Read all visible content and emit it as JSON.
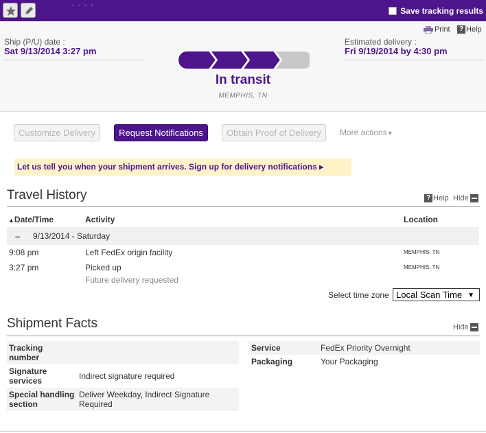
{
  "topbar": {
    "save_label": "Save tracking results",
    "dots": "- - - -"
  },
  "summary": {
    "print_label": "Print",
    "help_label": "Help",
    "ship_label": "Ship (P/U) date :",
    "ship_value": "Sat 9/13/2014 3:27 pm",
    "est_label": "Estimated delivery :",
    "est_value": "Fri 9/19/2014 by 4:30 pm",
    "progress_steps_completed": 3,
    "progress_steps_total": 4,
    "status": "In transit",
    "status_location": "MEMPHIS, TN"
  },
  "actions": {
    "customize": "Customize Delivery",
    "request": "Request Notifications",
    "proof": "Obtain Proof of Delivery",
    "more": "More actions"
  },
  "banner": {
    "text": "Let us tell you when your shipment arrives. Sign up for delivery notifications ▸"
  },
  "travel": {
    "title": "Travel History",
    "help": "Help",
    "hide": "Hide",
    "col_date": "Date/Time",
    "col_activity": "Activity",
    "col_location": "Location",
    "date_group": "9/13/2014 - Saturday",
    "rows": [
      {
        "time": "9:08 pm",
        "activity": "Left FedEx origin facility",
        "location": "MEMPHIS, TN",
        "note": ""
      },
      {
        "time": "3:27 pm",
        "activity": "Picked up",
        "location": "MEMPHIS, TN",
        "note": "Future delivery requested"
      }
    ],
    "tz_label": "Select time zone",
    "tz_value": "Local Scan Time"
  },
  "facts": {
    "title": "Shipment Facts",
    "hide": "Hide",
    "left": [
      {
        "label": "Tracking number",
        "value": ""
      },
      {
        "label": "Signature services",
        "value": "Indirect signature required"
      },
      {
        "label": "Special handling section",
        "value": "Deliver Weekday, Indirect Signature Required"
      }
    ],
    "right": [
      {
        "label": "Service",
        "value": "FedEx Priority Overnight"
      },
      {
        "label": "Packaging",
        "value": "Your Packaging"
      }
    ]
  },
  "colors": {
    "brand_purple": "#4d148c",
    "progress_inactive": "#c8c8c8",
    "banner_bg": "#fdf2c8"
  }
}
